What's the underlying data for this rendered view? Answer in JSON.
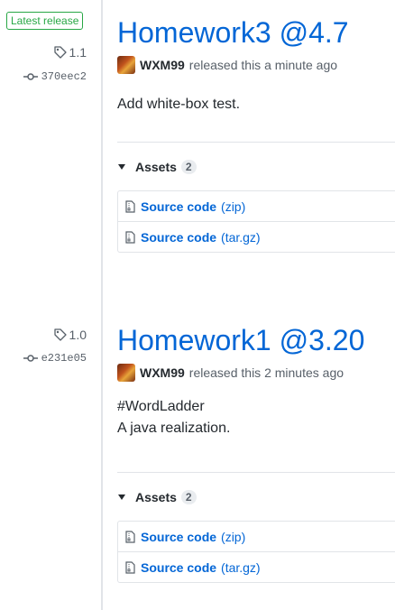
{
  "releases": [
    {
      "latest_badge": "Latest release",
      "tag": "1.1",
      "commit": "370eec2",
      "title": "Homework3 @4.7",
      "author": "WXM99",
      "released_text": "released this a minute ago",
      "notes": [
        "Add white-box test."
      ],
      "assets_label": "Assets",
      "assets_count": "2",
      "assets": [
        {
          "name": "Source code",
          "type": "(zip)"
        },
        {
          "name": "Source code",
          "type": "(tar.gz)"
        }
      ]
    },
    {
      "tag": "1.0",
      "commit": "e231e05",
      "title": "Homework1 @3.20",
      "author": "WXM99",
      "released_text": "released this 2 minutes ago",
      "notes": [
        "#WordLadder",
        "A java realization."
      ],
      "assets_label": "Assets",
      "assets_count": "2",
      "assets": [
        {
          "name": "Source code",
          "type": "(zip)"
        },
        {
          "name": "Source code",
          "type": "(tar.gz)"
        }
      ]
    }
  ],
  "colors": {
    "link": "#0366d6",
    "latest": "#28a745",
    "muted": "#586069",
    "border": "#e1e4e8"
  }
}
